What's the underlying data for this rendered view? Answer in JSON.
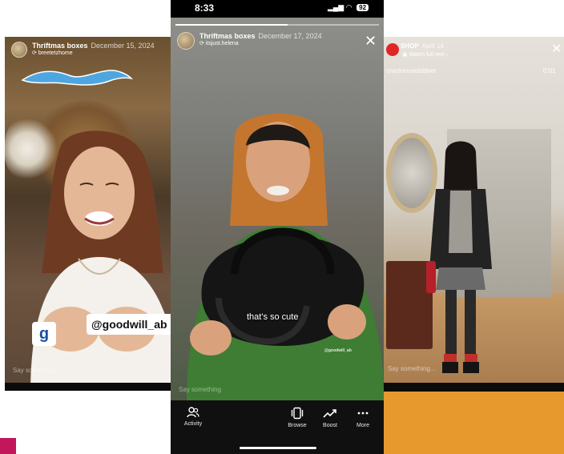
{
  "left_story": {
    "title": "Thriftmas boxes",
    "date": "December 15, 2024",
    "username": "breetetzhome",
    "sticker_tag": "@goodwill_ab",
    "input_placeholder": "Say something..."
  },
  "middle_story": {
    "status_time": "8:33",
    "battery": "92",
    "title": "Thriftmas boxes",
    "date": "December 17, 2024",
    "username": "itsjust.helena",
    "caption": "that's so cute",
    "watermark": "@goodwill_ab",
    "input_placeholder": "Say something",
    "progress": 0.55,
    "actions": [
      {
        "label": "Activity",
        "icon": "people-icon"
      },
      {
        "label": "Browse",
        "icon": "browse-icon"
      },
      {
        "label": "Boost",
        "icon": "trend-up-icon"
      },
      {
        "label": "More",
        "icon": "more-icon"
      }
    ]
  },
  "right_story": {
    "title": "SHOP",
    "date": "April 14",
    "watch_link": "Watch full reel",
    "username": "onedressedddeer",
    "timecode": "0:01",
    "input_placeholder": "Say something..."
  },
  "colors": {
    "orange_accent": "#e8992e",
    "pink_accent": "#c2185b",
    "shop_badge": "#e02626"
  }
}
